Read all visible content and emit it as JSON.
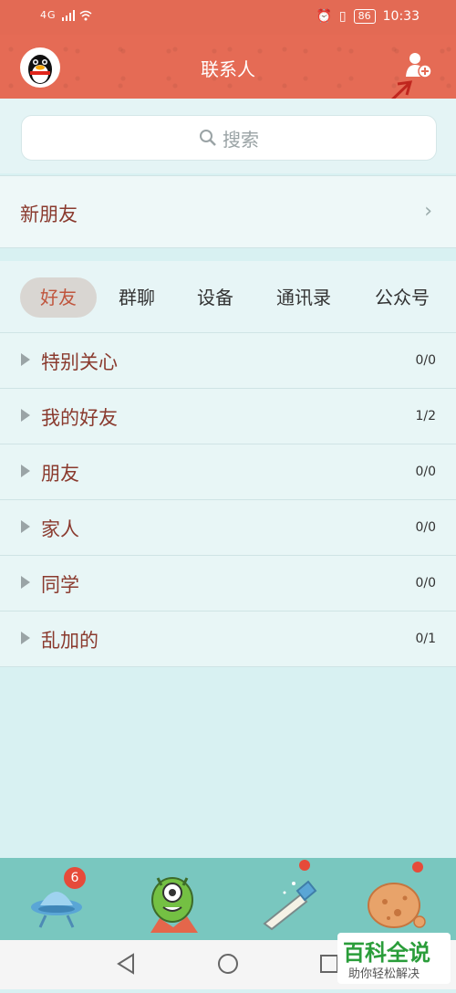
{
  "statusbar": {
    "network": "4G",
    "battery": "86",
    "time": "10:33"
  },
  "header": {
    "title": "联系人"
  },
  "search": {
    "placeholder": "搜索"
  },
  "new_friend": {
    "label": "新朋友",
    "chevron": "›"
  },
  "tabs": [
    {
      "label": "好友",
      "active": true
    },
    {
      "label": "群聊",
      "active": false
    },
    {
      "label": "设备",
      "active": false
    },
    {
      "label": "通讯录",
      "active": false
    },
    {
      "label": "公众号",
      "active": false
    }
  ],
  "groups": [
    {
      "name": "特别关心",
      "count": "0/0"
    },
    {
      "name": "我的好友",
      "count": "1/2"
    },
    {
      "name": "朋友",
      "count": "0/0"
    },
    {
      "name": "家人",
      "count": "0/0"
    },
    {
      "name": "同学",
      "count": "0/0"
    },
    {
      "name": "乱加的",
      "count": "0/1"
    }
  ],
  "bottom_nav": {
    "messages_badge": "6"
  },
  "watermark": {
    "brand": "百科全说",
    "tagline": "助你轻松解决"
  },
  "colors": {
    "accent": "#e56b55",
    "text_group": "#8a3a2e",
    "badge": "#e64b3a",
    "nav_bg": "#79c7bf"
  }
}
